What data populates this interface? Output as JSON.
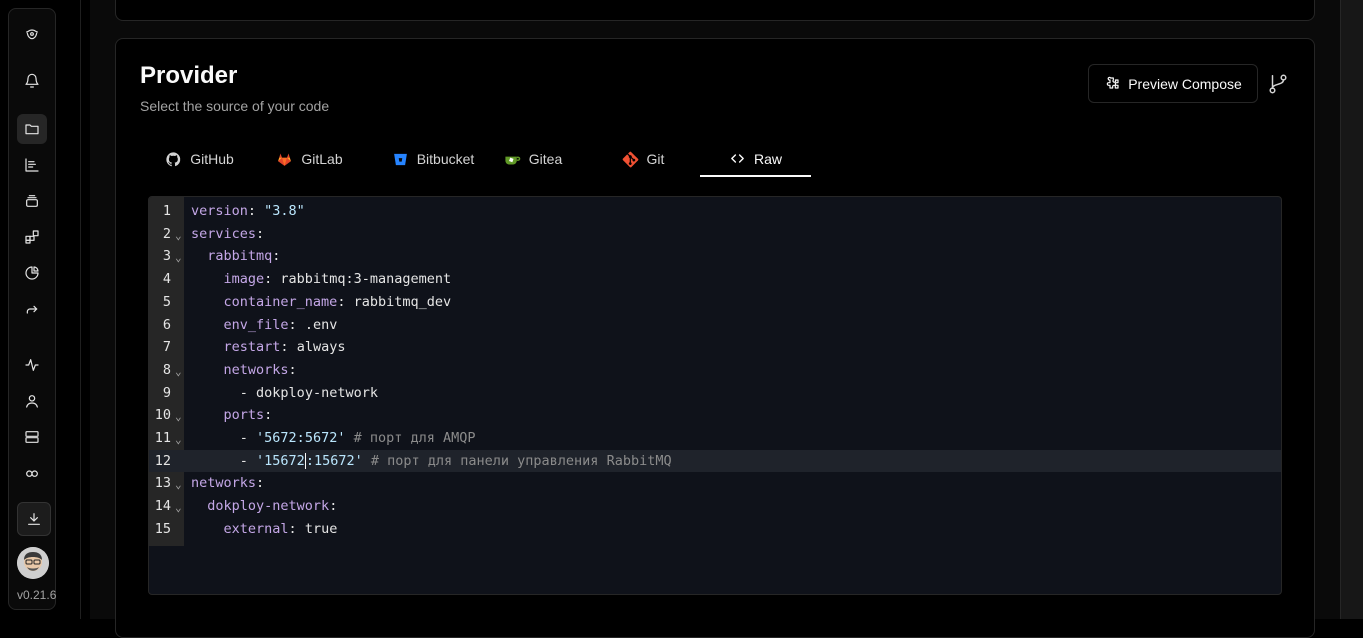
{
  "sidebar": {
    "version": "v0.21.6",
    "items": [
      {
        "icon": "logo-icon"
      },
      {
        "icon": "bell-icon"
      },
      {
        "icon": "folder-icon"
      },
      {
        "icon": "chart-icon"
      },
      {
        "icon": "layers-icon"
      },
      {
        "icon": "blocks-icon"
      },
      {
        "icon": "pie-chart-icon"
      },
      {
        "icon": "forward-icon"
      },
      {
        "icon": "activity-icon"
      },
      {
        "icon": "user-icon"
      },
      {
        "icon": "server-icon"
      },
      {
        "icon": "link-icon"
      },
      {
        "icon": "download-icon"
      }
    ]
  },
  "provider": {
    "title": "Provider",
    "subtitle": "Select the source of your code",
    "preview_label": "Preview Compose"
  },
  "tabs": [
    {
      "label": "GitHub",
      "icon": "github-icon"
    },
    {
      "label": "GitLab",
      "icon": "gitlab-icon"
    },
    {
      "label": "Bitbucket",
      "icon": "bitbucket-icon"
    },
    {
      "label": "Gitea",
      "icon": "gitea-icon"
    },
    {
      "label": "Git",
      "icon": "git-icon"
    },
    {
      "label": "Raw",
      "icon": "code-icon",
      "active": true
    }
  ],
  "editor": {
    "current_line": 12,
    "lines": [
      {
        "n": "1",
        "fold": false,
        "indent": "",
        "key": "version",
        "sep": ": ",
        "value": "\"3.8\"",
        "vtype": "s",
        "comment": ""
      },
      {
        "n": "2",
        "fold": true,
        "indent": "",
        "key": "services",
        "sep": ":",
        "value": "",
        "vtype": "p",
        "comment": ""
      },
      {
        "n": "3",
        "fold": true,
        "indent": "  ",
        "key": "rabbitmq",
        "sep": ":",
        "value": "",
        "vtype": "p",
        "comment": ""
      },
      {
        "n": "4",
        "fold": false,
        "indent": "    ",
        "key": "image",
        "sep": ": ",
        "value": "rabbitmq:3-management",
        "vtype": "p",
        "comment": ""
      },
      {
        "n": "5",
        "fold": false,
        "indent": "    ",
        "key": "container_name",
        "sep": ": ",
        "value": "rabbitmq_dev",
        "vtype": "p",
        "comment": ""
      },
      {
        "n": "6",
        "fold": false,
        "indent": "    ",
        "key": "env_file",
        "sep": ": ",
        "value": ".env",
        "vtype": "p",
        "comment": ""
      },
      {
        "n": "7",
        "fold": false,
        "indent": "    ",
        "key": "restart",
        "sep": ": ",
        "value": "always",
        "vtype": "p",
        "comment": ""
      },
      {
        "n": "8",
        "fold": true,
        "indent": "    ",
        "key": "networks",
        "sep": ":",
        "value": "",
        "vtype": "p",
        "comment": ""
      },
      {
        "n": "9",
        "fold": false,
        "indent": "      ",
        "key": "",
        "sep": "- ",
        "value": "dokploy-network",
        "vtype": "p",
        "comment": ""
      },
      {
        "n": "10",
        "fold": true,
        "indent": "    ",
        "key": "ports",
        "sep": ":",
        "value": "",
        "vtype": "p",
        "comment": ""
      },
      {
        "n": "11",
        "fold": true,
        "indent": "      ",
        "key": "",
        "sep": "- ",
        "value": "'5672:5672'",
        "vtype": "s",
        "comment": " # порт для AMQP"
      },
      {
        "n": "12",
        "fold": false,
        "indent": "      ",
        "key": "",
        "sep": "- ",
        "value": "'15672:15672'",
        "vtype": "s",
        "comment": " # порт для панели управления RabbitMQ"
      },
      {
        "n": "13",
        "fold": true,
        "indent": "",
        "key": "networks",
        "sep": ":",
        "value": "",
        "vtype": "p",
        "comment": ""
      },
      {
        "n": "14",
        "fold": true,
        "indent": "  ",
        "key": "dokploy-network",
        "sep": ":",
        "value": "",
        "vtype": "p",
        "comment": ""
      },
      {
        "n": "15",
        "fold": false,
        "indent": "    ",
        "key": "external",
        "sep": ": ",
        "value": "true",
        "vtype": "p",
        "comment": ""
      }
    ]
  }
}
